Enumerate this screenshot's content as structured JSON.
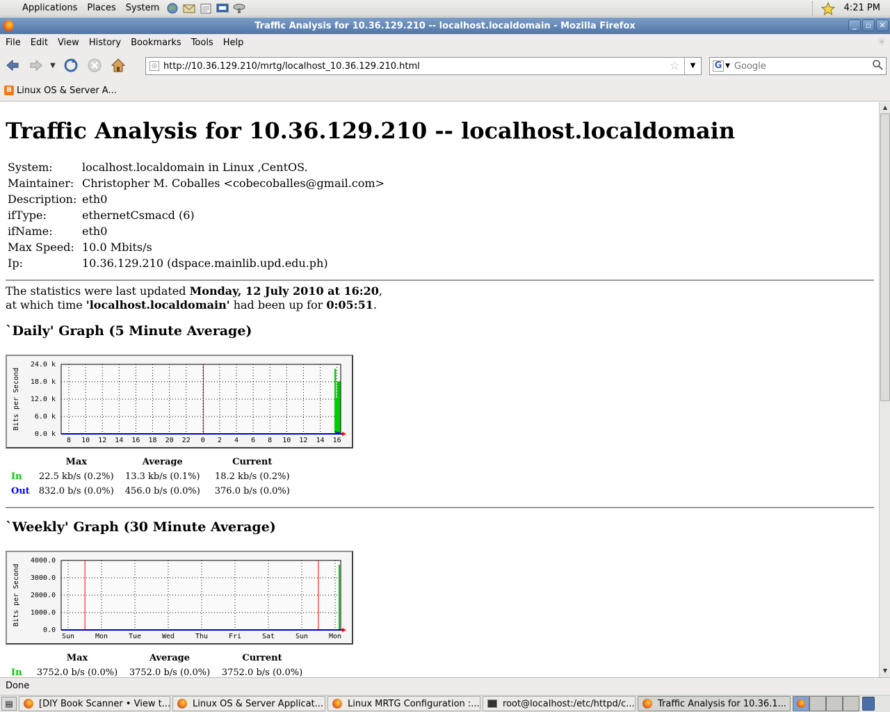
{
  "panel": {
    "menus": [
      "Applications",
      "Places",
      "System"
    ],
    "clock": "4:21 PM"
  },
  "window": {
    "title": "Traffic Analysis for 10.36.129.210 -- localhost.localdomain - Mozilla Firefox"
  },
  "menubar": [
    "File",
    "Edit",
    "View",
    "History",
    "Bookmarks",
    "Tools",
    "Help"
  ],
  "navbar": {
    "url": "http://10.36.129.210/mrtg/localhost_10.36.129.210.html",
    "search_placeholder": "Google"
  },
  "bookmarks": [
    {
      "label": "Linux OS & Server A..."
    }
  ],
  "page": {
    "heading": "Traffic Analysis for 10.36.129.210 -- localhost.localdomain",
    "info": [
      {
        "key": "System:",
        "value": "localhost.localdomain in Linux ,CentOS."
      },
      {
        "key": "Maintainer:",
        "value": "Christopher M. Coballes <cobecoballes@gmail.com>"
      },
      {
        "key": "Description:",
        "value": "eth0"
      },
      {
        "key": "ifType:",
        "value": "ethernetCsmacd (6)"
      },
      {
        "key": "ifName:",
        "value": "eth0"
      },
      {
        "key": "Max Speed:",
        "value": "10.0 Mbits/s"
      },
      {
        "key": "Ip:",
        "value": "10.36.129.210 (dspace.mainlib.upd.edu.ph)"
      }
    ],
    "updated": {
      "prefix": "The statistics were last updated ",
      "date": "Monday, 12 July 2010 at 16:20",
      "mid1": ",",
      "line2_prefix": "at which time ",
      "host": "'localhost.localdomain'",
      "mid2": " had been up for ",
      "uptime": "0:05:51",
      "suffix": "."
    },
    "daily": {
      "title": "`Daily' Graph (5 Minute Average)",
      "headers": [
        "Max",
        "Average",
        "Current"
      ],
      "rows": [
        {
          "label": "In",
          "color": "#00cc00",
          "values": [
            "22.5 kb/s (0.2%)",
            "13.3 kb/s (0.1%)",
            "18.2 kb/s (0.2%)"
          ]
        },
        {
          "label": "Out",
          "color": "#0000ff",
          "values": [
            "832.0 b/s (0.0%)",
            "456.0 b/s (0.0%)",
            "376.0 b/s (0.0%)"
          ]
        }
      ]
    },
    "weekly": {
      "title": "`Weekly' Graph (30 Minute Average)",
      "headers": [
        "Max",
        "Average",
        "Current"
      ],
      "rows": [
        {
          "label": "In",
          "color": "#00cc00",
          "values": [
            "3752.0 b/s (0.0%)",
            "3752.0 b/s (0.0%)",
            "3752.0 b/s (0.0%)"
          ]
        }
      ]
    }
  },
  "chart_data": [
    {
      "type": "area",
      "ylabel": "Bits per Second",
      "y_ticks": [
        "24.0 k",
        "18.0 k",
        "12.0 k",
        "6.0 k",
        "0.0 k"
      ],
      "ylim": [
        0,
        24000
      ],
      "x_ticks": [
        "8",
        "10",
        "12",
        "14",
        "16",
        "18",
        "20",
        "22",
        "0",
        "2",
        "4",
        "6",
        "8",
        "10",
        "12",
        "14",
        "16"
      ],
      "grid": true,
      "series": [
        {
          "color": "#00cc00",
          "x": [
            15.8,
            15.9,
            16.0,
            16.1,
            16.2,
            16.3
          ],
          "values": [
            22500,
            12000,
            12500,
            18000,
            12000,
            18200
          ]
        },
        {
          "color": "#0000ff",
          "x": [
            15.8,
            16.0,
            16.3
          ],
          "values": [
            832,
            456,
            376
          ]
        }
      ]
    },
    {
      "type": "area",
      "ylabel": "Bits per Second",
      "y_ticks": [
        "4000.0",
        "3000.0",
        "2000.0",
        "1000.0",
        "0.0"
      ],
      "ylim": [
        0,
        4000
      ],
      "x_ticks": [
        "Sun",
        "Mon",
        "Tue",
        "Wed",
        "Thu",
        "Fri",
        "Sat",
        "Sun",
        "Mon"
      ],
      "grid": true,
      "series": [
        {
          "color": "#00cc00",
          "values": [
            3752
          ]
        }
      ]
    }
  ],
  "status": "Done",
  "taskbar": [
    {
      "label": "[DIY Book Scanner • View t..."
    },
    {
      "label": "Linux OS & Server Applicat..."
    },
    {
      "label": "Linux MRTG Configuration :..."
    },
    {
      "label": "root@localhost:/etc/httpd/c..."
    },
    {
      "label": "Traffic Analysis for 10.36.1..."
    }
  ]
}
